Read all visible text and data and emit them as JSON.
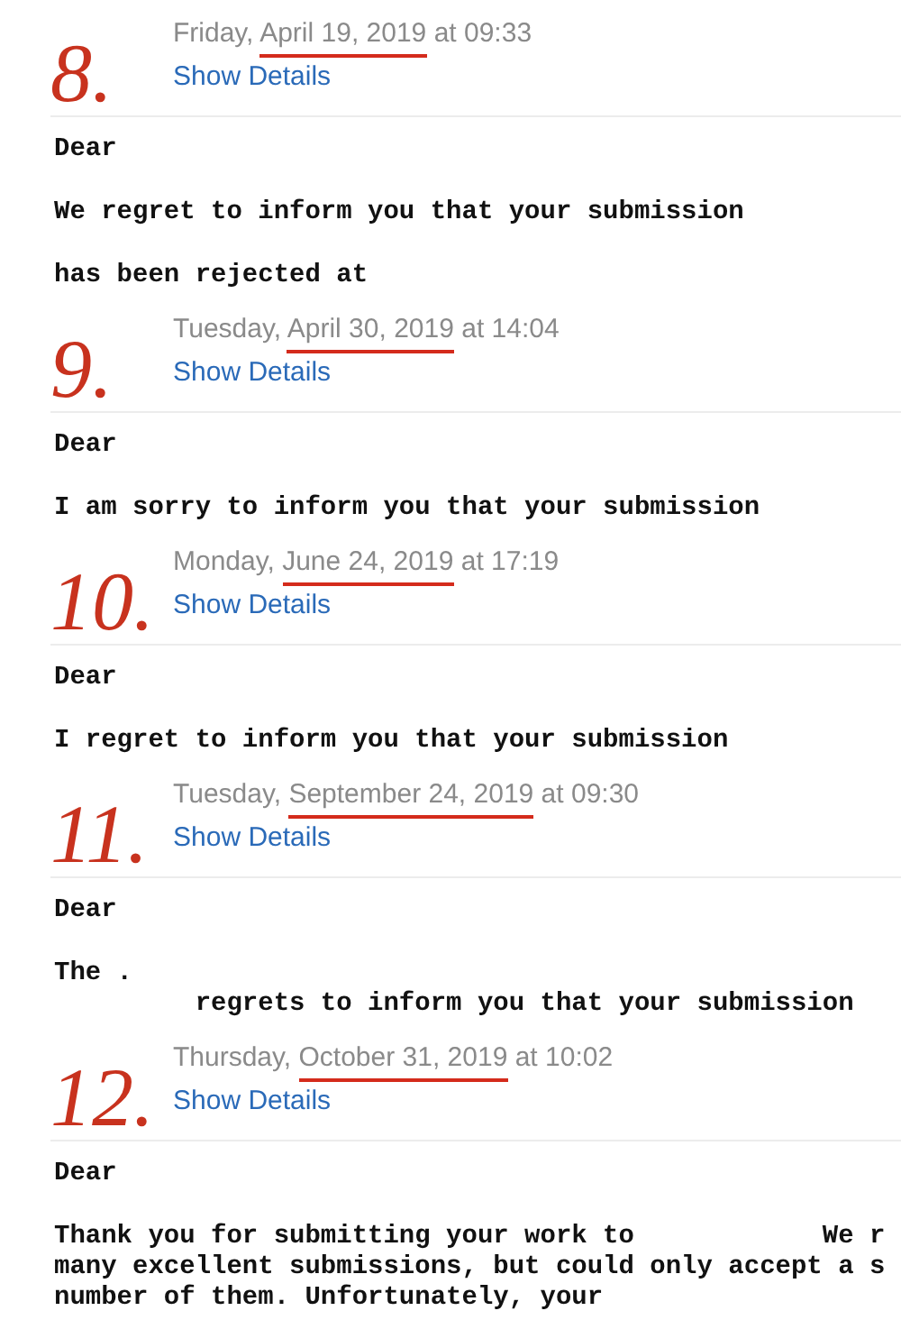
{
  "emails": [
    {
      "number": "8.",
      "weekday": "Friday, ",
      "date": "April 19, 2019",
      "time": " at 09:33",
      "link": "Show Details",
      "paragraphs": [
        [
          "Dear"
        ],
        [
          "We regret to inform you that your submission"
        ],
        [
          "has been rejected at"
        ]
      ]
    },
    {
      "number": "9.",
      "weekday": "Tuesday, ",
      "date": "April 30, 2019",
      "time": " at 14:04",
      "link": "Show Details",
      "paragraphs": [
        [
          "Dear"
        ],
        [
          "I am sorry to inform you that your submission"
        ]
      ]
    },
    {
      "number": "10.",
      "weekday": "Monday, ",
      "date": "June 24, 2019",
      "time": " at 17:19",
      "link": "Show Details",
      "paragraphs": [
        [
          "Dear"
        ],
        [
          "I regret to inform you that your submission"
        ]
      ]
    },
    {
      "number": "11.",
      "weekday": "Tuesday, ",
      "date": "September 24, 2019",
      "time": " at 09:30",
      "link": "Show Details",
      "paragraphs": [
        [
          "Dear"
        ],
        [
          "The .",
          "         regrets to inform you that your submission"
        ]
      ]
    },
    {
      "number": "12.",
      "weekday": "Thursday, ",
      "date": "October 31, 2019",
      "time": " at 10:02",
      "link": "Show Details",
      "paragraphs": [
        [
          "Dear"
        ],
        [
          "Thank you for submitting your work to            We r",
          "many excellent submissions, but could only accept a s",
          "number of them. Unfortunately, your"
        ]
      ]
    }
  ]
}
